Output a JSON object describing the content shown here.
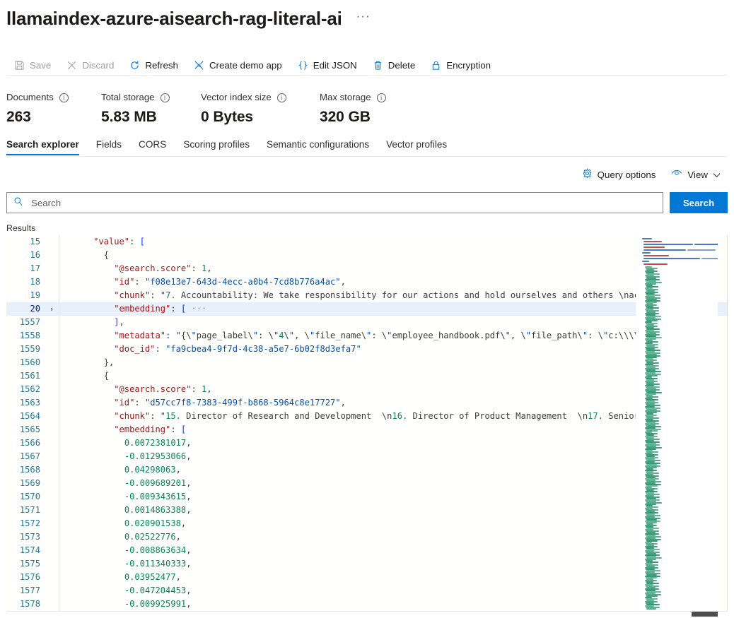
{
  "header": {
    "title": "llamaindex-azure-aisearch-rag-literal-ai",
    "more_label": "···"
  },
  "commandbar": {
    "items": [
      {
        "label": "Save",
        "icon": "save-icon",
        "disabled": true
      },
      {
        "label": "Discard",
        "icon": "close-x-icon",
        "disabled": true
      },
      {
        "label": "Refresh",
        "icon": "refresh-icon",
        "disabled": false
      },
      {
        "label": "Create demo app",
        "icon": "demo-app-icon",
        "disabled": false
      },
      {
        "label": "Edit JSON",
        "icon": "braces-icon",
        "disabled": false
      },
      {
        "label": "Delete",
        "icon": "trash-icon",
        "disabled": false
      },
      {
        "label": "Encryption",
        "icon": "lock-icon",
        "disabled": false
      }
    ]
  },
  "stats": [
    {
      "label": "Documents",
      "value": "263"
    },
    {
      "label": "Total storage",
      "value": "5.83 MB"
    },
    {
      "label": "Vector index size",
      "value": "0 Bytes"
    },
    {
      "label": "Max storage",
      "value": "320 GB"
    }
  ],
  "tabs": [
    {
      "label": "Search explorer",
      "active": true
    },
    {
      "label": "Fields",
      "active": false
    },
    {
      "label": "CORS",
      "active": false
    },
    {
      "label": "Scoring profiles",
      "active": false
    },
    {
      "label": "Semantic configurations",
      "active": false
    },
    {
      "label": "Vector profiles",
      "active": false
    }
  ],
  "query_actions": [
    {
      "label": "Query options",
      "icon": "gear-icon"
    },
    {
      "label": "View",
      "icon": "eye-icon",
      "chevron": "∨"
    }
  ],
  "search": {
    "placeholder": "Search",
    "value": "",
    "icon": "search-icon",
    "button_label": "Search"
  },
  "results": {
    "label": "Results"
  },
  "editor": {
    "accent_color": "#0078d4",
    "highlight_line": 20,
    "lines": [
      {
        "num": 15,
        "fold": "",
        "text": "    \"value\": ["
      },
      {
        "num": 16,
        "fold": "",
        "text": "      {"
      },
      {
        "num": 17,
        "fold": "",
        "text": "        \"@search.score\": 1,"
      },
      {
        "num": 18,
        "fold": "",
        "text": "        \"id\": \"f08e13e7-643d-4ecc-a0b4-7cd8b776a4ac\","
      },
      {
        "num": 19,
        "fold": "",
        "text": "        \"chunk\": \"7. Accountability: We take responsibility for our actions and hold ourselves and others \\nac"
      },
      {
        "num": 20,
        "fold": "›",
        "text": "        \"embedding\": [ ···"
      },
      {
        "num": 1557,
        "fold": "",
        "text": "        ],"
      },
      {
        "num": 1558,
        "fold": "",
        "text": "        \"metadata\": \"{\\\"page_label\\\": \\\"4\\\", \\\"file_name\\\": \\\"employee_handbook.pdf\\\", \\\"file_path\\\": \\\"c:\\\\\\\\"
      },
      {
        "num": 1559,
        "fold": "",
        "text": "        \"doc_id\": \"fa9cbea4-9f7d-4c38-a5e7-6b02f8d3efa7\""
      },
      {
        "num": 1560,
        "fold": "",
        "text": "      },"
      },
      {
        "num": 1561,
        "fold": "",
        "text": "      {"
      },
      {
        "num": 1562,
        "fold": "",
        "text": "        \"@search.score\": 1,"
      },
      {
        "num": 1563,
        "fold": "",
        "text": "        \"id\": \"d57cc7f8-7383-499f-b868-5964c8e17727\","
      },
      {
        "num": 1564,
        "fold": "",
        "text": "        \"chunk\": \"15. Director of Research and Development  \\n16. Director of Product Management  \\n17. Senior"
      },
      {
        "num": 1565,
        "fold": "",
        "text": "        \"embedding\": ["
      },
      {
        "num": 1566,
        "fold": "",
        "text": "          0.0072381017,"
      },
      {
        "num": 1567,
        "fold": "",
        "text": "          -0.012953066,"
      },
      {
        "num": 1568,
        "fold": "",
        "text": "          0.04298063,"
      },
      {
        "num": 1569,
        "fold": "",
        "text": "          -0.009689201,"
      },
      {
        "num": 1570,
        "fold": "",
        "text": "          -0.009343615,"
      },
      {
        "num": 1571,
        "fold": "",
        "text": "          0.0014863388,"
      },
      {
        "num": 1572,
        "fold": "",
        "text": "          0.020901538,"
      },
      {
        "num": 1573,
        "fold": "",
        "text": "          0.02522776,"
      },
      {
        "num": 1574,
        "fold": "",
        "text": "          -0.008863634,"
      },
      {
        "num": 1575,
        "fold": "",
        "text": "          -0.011340333,"
      },
      {
        "num": 1576,
        "fold": "",
        "text": "          0.03952477,"
      },
      {
        "num": 1577,
        "fold": "",
        "text": "          -0.047204453,"
      },
      {
        "num": 1578,
        "fold": "",
        "text": "          -0.009925991,"
      }
    ]
  }
}
